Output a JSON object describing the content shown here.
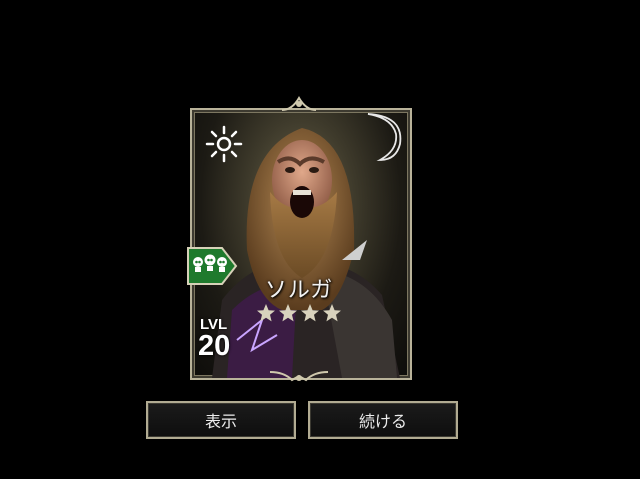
{
  "hero_card": {
    "name": "ソルガ",
    "stars": 4,
    "level_label": "LVL",
    "level_value": "20",
    "element_icon": "sun-icon",
    "faction_icon": "skulls-icon",
    "faction_color": "#1f7a2d",
    "frame_color": "#b9b39a"
  },
  "buttons": {
    "show_label": "表示",
    "continue_label": "続ける"
  }
}
